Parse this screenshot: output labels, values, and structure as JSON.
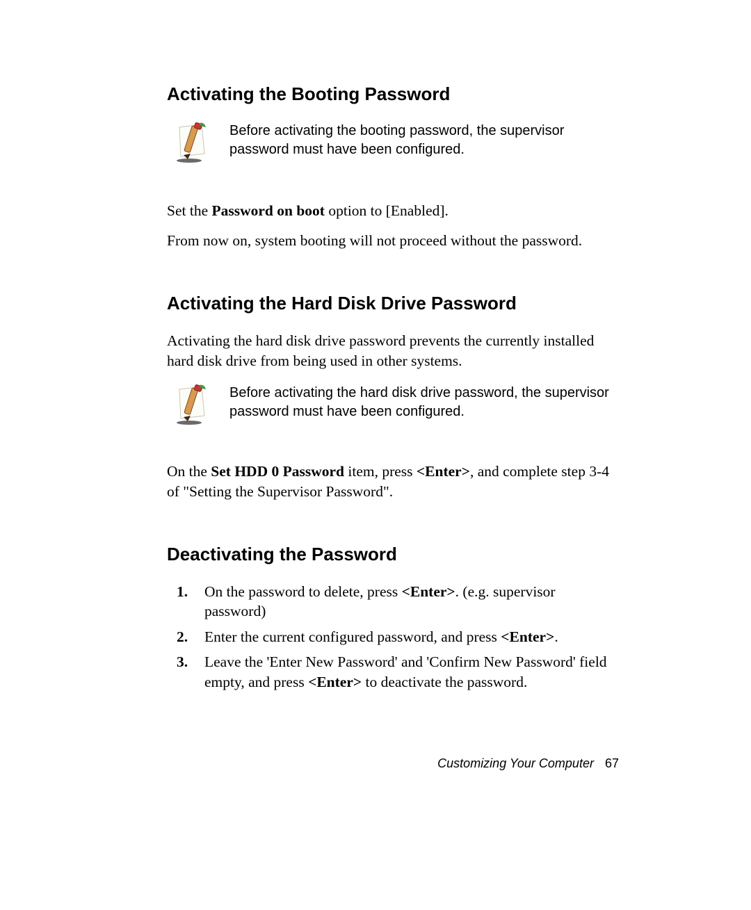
{
  "section1": {
    "heading": "Activating the Booting Password",
    "note": "Before activating the booting password, the supervisor password must have been configured.",
    "para1_pre": "Set the ",
    "para1_bold": "Password on boot",
    "para1_post": " option to [Enabled].",
    "para2": "From now on, system booting will not proceed without the password."
  },
  "section2": {
    "heading": "Activating the Hard Disk Drive Password",
    "intro": "Activating the hard disk drive password prevents the currently installed hard disk drive from being used in other systems.",
    "note": "Before activating the hard disk drive password, the supervisor password must have been configured.",
    "para1_pre": "On the ",
    "para1_bold1": "Set HDD 0 Password",
    "para1_mid": " item, press ",
    "para1_bold2": "<Enter>",
    "para1_post": ", and complete step 3-4 of \"Setting the Supervisor Password\"."
  },
  "section3": {
    "heading": "Deactivating the Password",
    "steps": [
      {
        "num": "1.",
        "pre": "On the password to delete, press ",
        "b1": "<Enter>",
        "post": ". (e.g. supervisor password)"
      },
      {
        "num": "2.",
        "pre": "Enter the current configured password, and press ",
        "b1": "<Enter>",
        "post": "."
      },
      {
        "num": "3.",
        "pre": "Leave the 'Enter New Password' and 'Confirm New Password' field empty, and press ",
        "b1": "<Enter>",
        "post": " to deactivate the password."
      }
    ]
  },
  "footer": {
    "text": "Customizing Your Computer",
    "page": "67"
  }
}
